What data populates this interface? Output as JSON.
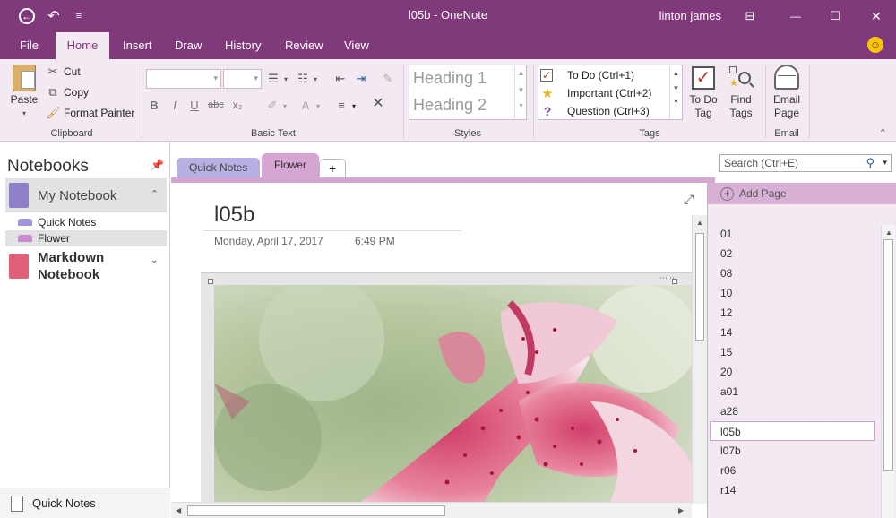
{
  "window": {
    "title": "l05b  -  OneNote",
    "user": "linton james",
    "buttons": {
      "back": "←",
      "undo": "↶",
      "qat_more": "≡",
      "ribbon_display": "⊟",
      "minimize": "—",
      "maximize": "☐",
      "close": "✕"
    }
  },
  "menu": {
    "tabs": [
      "File",
      "Home",
      "Insert",
      "Draw",
      "History",
      "Review",
      "View"
    ],
    "active": "Home",
    "smiley": "☺"
  },
  "ribbon": {
    "clipboard": {
      "label": "Clipboard",
      "paste": "Paste",
      "cut": "Cut",
      "copy": "Copy",
      "format_painter": "Format Painter"
    },
    "basic_text": {
      "label": "Basic Text",
      "bold": "B",
      "italic": "I",
      "underline": "U",
      "strikethrough": "abc",
      "subscript": "x₂"
    },
    "styles": {
      "label": "Styles",
      "items": [
        "Heading 1",
        "Heading 2"
      ]
    },
    "tags": {
      "label": "Tags",
      "items": [
        {
          "label": "To Do (Ctrl+1)",
          "icon": "checkbox-icon"
        },
        {
          "label": "Important (Ctrl+2)",
          "icon": "star-icon"
        },
        {
          "label": "Question (Ctrl+3)",
          "icon": "question-icon"
        }
      ],
      "todo_tag": "To Do\nTag",
      "todo_tag_l1": "To Do",
      "todo_tag_l2": "Tag",
      "find_tags_l1": "Find",
      "find_tags_l2": "Tags"
    },
    "email": {
      "label": "Email",
      "email_page_l1": "Email",
      "email_page_l2": "Page"
    }
  },
  "notebooks": {
    "title": "Notebooks",
    "items": [
      {
        "name": "My Notebook",
        "color": "#8f7fc9",
        "expanded": true
      },
      {
        "name": "Markdown Notebook",
        "name_l1": "Markdown",
        "name_l2": "Notebook",
        "color": "#e0607a",
        "expanded": false
      }
    ],
    "sections": [
      {
        "name": "Quick Notes",
        "color": "#9f95d8"
      },
      {
        "name": "Flower",
        "color": "#c98bd0",
        "selected": true
      }
    ],
    "bottom": "Quick Notes"
  },
  "section_tabs": {
    "tabs": [
      {
        "name": "Quick Notes",
        "color": "#b7b0e2"
      },
      {
        "name": "Flower",
        "color": "#d6a6d3",
        "active": true
      }
    ],
    "add": "+"
  },
  "search": {
    "placeholder": "Search (Ctrl+E)"
  },
  "page": {
    "title": "l05b",
    "date": "Monday, April 17, 2017",
    "time": "6:49 PM"
  },
  "pages": {
    "add_label": "Add Page",
    "items": [
      "01",
      "02",
      "08",
      "10",
      "12",
      "14",
      "15",
      "20",
      "a01",
      "a28",
      "l05b",
      "l07b",
      "r06",
      "r14"
    ],
    "active": "l05b"
  },
  "colors": {
    "accent": "#80397b",
    "ribbon_bg": "#f3e9f3",
    "section_flower": "#d6a6d3",
    "section_quicknotes": "#b7b0e2"
  }
}
